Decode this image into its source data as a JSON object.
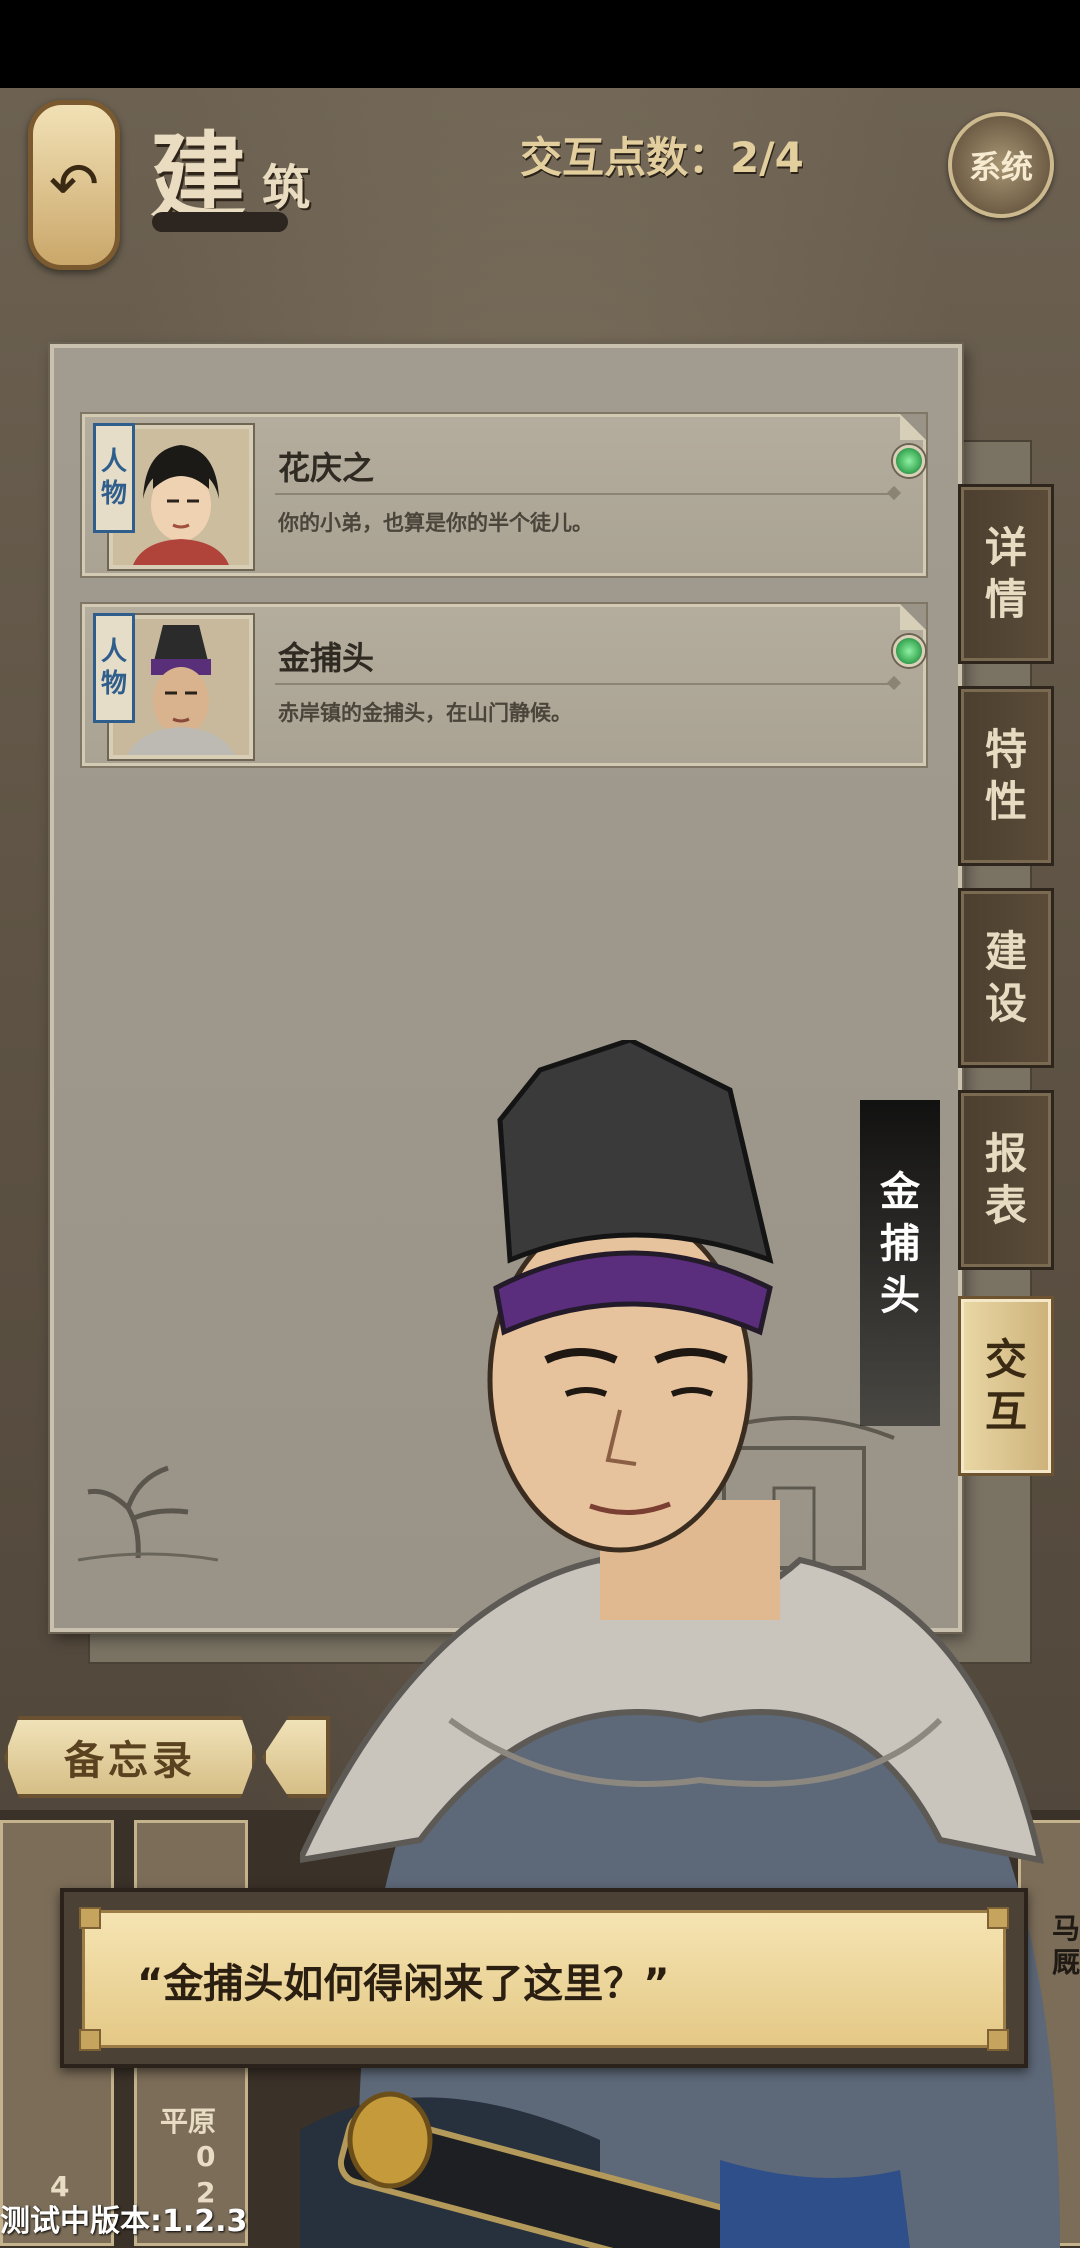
{
  "header": {
    "back_icon": "↶",
    "title_main": "建",
    "title_sub": "筑",
    "interaction_points": "交互点数：2/4",
    "system_button": "系统"
  },
  "characters": [
    {
      "tag": [
        "人",
        "物"
      ],
      "name": "花庆之",
      "description": "你的小弟，也算是你的半个徒儿。",
      "status_color": "#3fae5a"
    },
    {
      "tag": [
        "人",
        "物"
      ],
      "name": "金捕头",
      "description": "赤岸镇的金捕头，在山门静候。",
      "status_color": "#3fae5a"
    }
  ],
  "side_tabs": [
    {
      "chars": [
        "详",
        "情"
      ],
      "active": false
    },
    {
      "chars": [
        "特",
        "性"
      ],
      "active": false
    },
    {
      "chars": [
        "建",
        "设"
      ],
      "active": false
    },
    {
      "chars": [
        "报",
        "表"
      ],
      "active": false
    },
    {
      "chars": [
        "交",
        "互"
      ],
      "active": true
    }
  ],
  "memo_button": "备忘录",
  "speaker_name": [
    "金",
    "捕",
    "头"
  ],
  "dialog_text": "“金捕头如何得闲来了这里？”",
  "bottom": {
    "building_label": "平原",
    "count_a": "0",
    "count_b": "2",
    "count_c": "4",
    "right_label": "马厩"
  },
  "version_text": "测试中版本:1.2.3"
}
